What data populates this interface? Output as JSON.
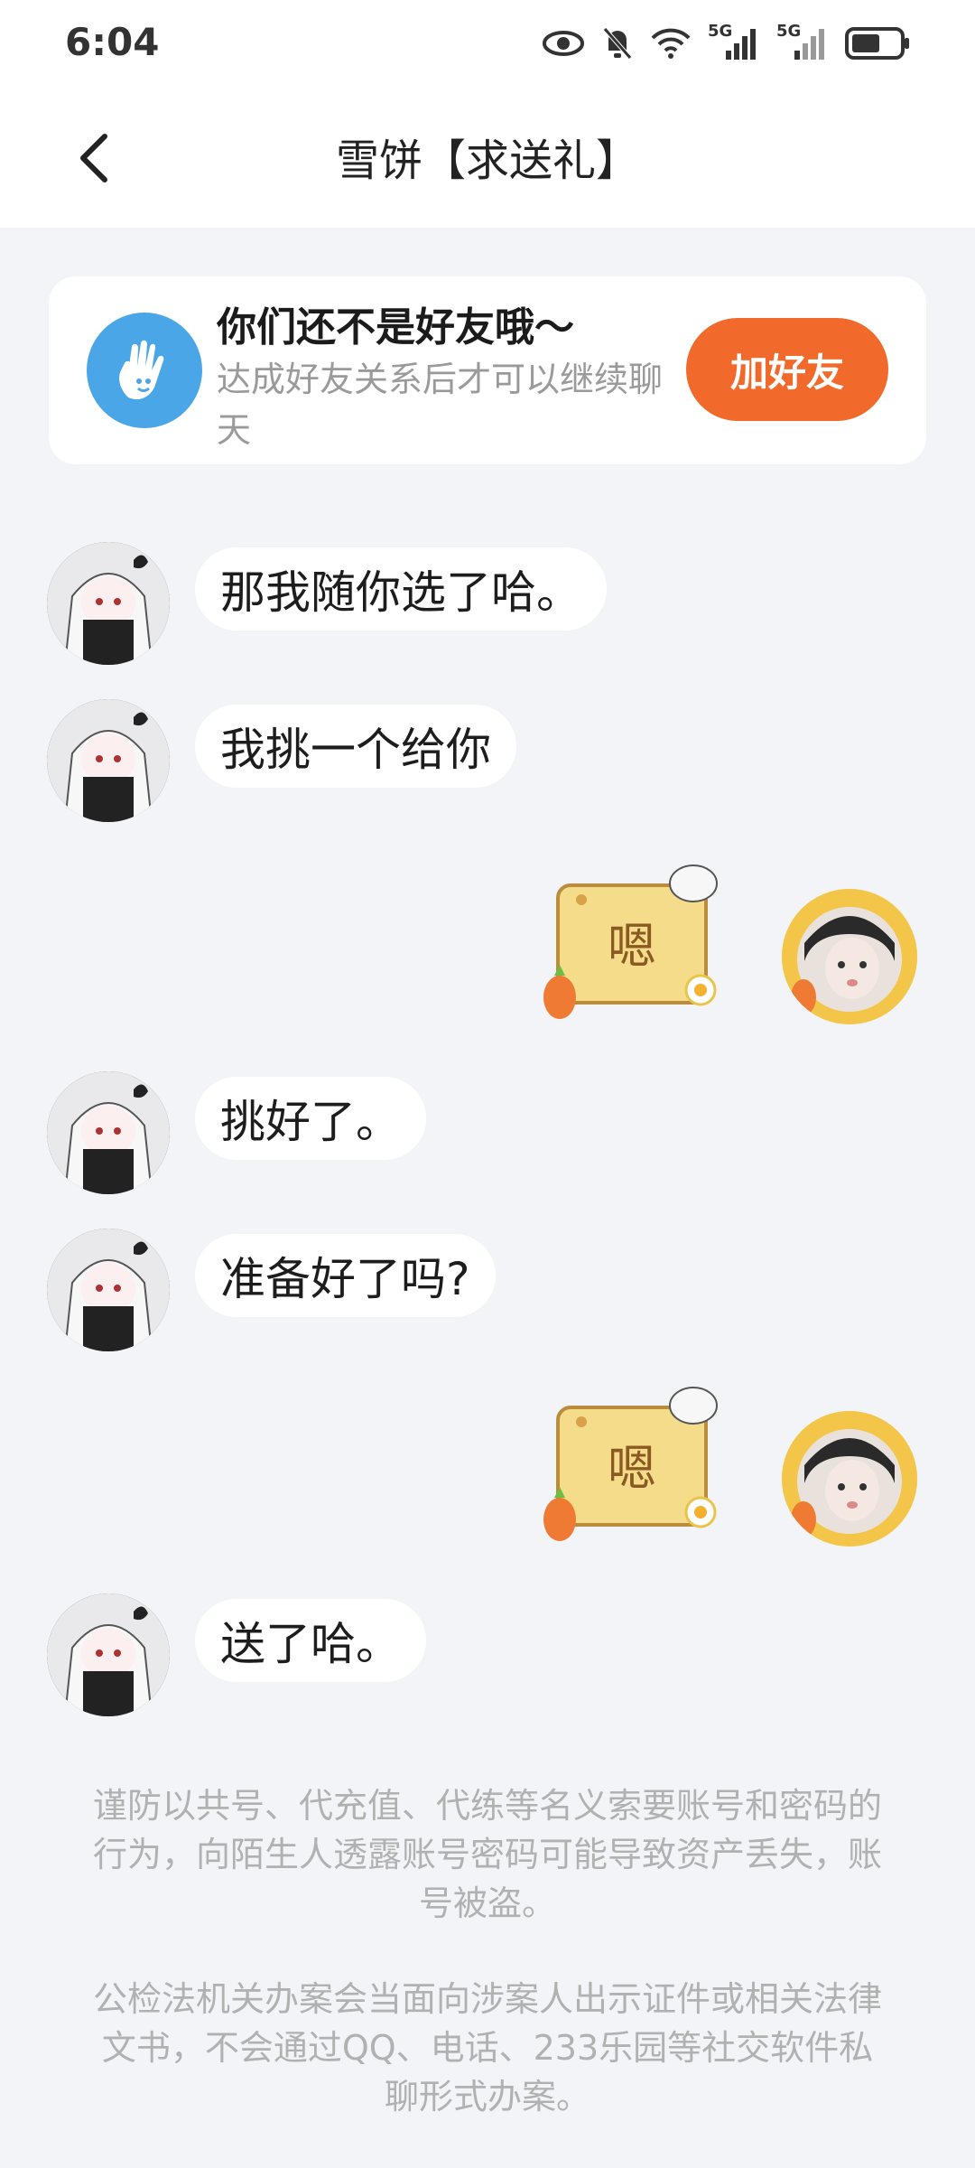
{
  "status": {
    "time": "6:04",
    "net1": "5G",
    "net2": "5G"
  },
  "header": {
    "title": "雪饼【求送礼】"
  },
  "friend_card": {
    "title": "你们还不是好友哦～",
    "subtitle": "达成好友关系后才可以继续聊天",
    "button": "加好友"
  },
  "messages": [
    {
      "side": "left",
      "text": "那我随你选了哈。"
    },
    {
      "side": "left",
      "text": "我挑一个给你"
    },
    {
      "side": "right",
      "sticker_text": "嗯"
    },
    {
      "side": "left",
      "text": "挑好了。"
    },
    {
      "side": "left",
      "text": "准备好了吗?"
    },
    {
      "side": "right",
      "sticker_text": "嗯"
    },
    {
      "side": "left",
      "text": "送了哈。"
    }
  ],
  "notices": [
    "谨防以共号、代充值、代练等名义索要账号和密码的行为，向陌生人透露账号密码可能导致资产丢失，账号被盗。",
    "公检法机关办案会当面向涉案人出示证件或相关法律文书，不会通过QQ、电话、233乐园等社交软件私聊形式办案。"
  ],
  "colors": {
    "accent": "#f26a2b",
    "hand_icon": "#4aa6e6"
  }
}
